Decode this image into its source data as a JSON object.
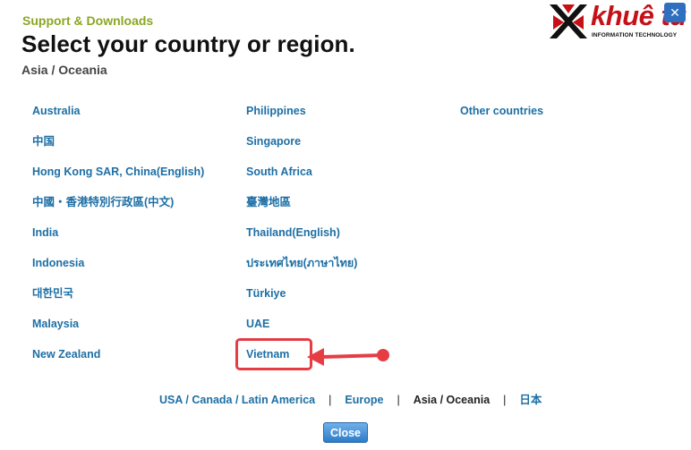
{
  "header": {
    "section": "Support & Downloads",
    "title": "Select your country or region.",
    "current_region": "Asia / Oceania"
  },
  "logo": {
    "brand": "khuê tú",
    "tagline": "INFORMATION TECHNOLOGY",
    "icon": "x-mark-logo-icon"
  },
  "columns": {
    "col1": [
      "Australia",
      "中国",
      "Hong Kong SAR, China(English)",
      "中國・香港特別行政區(中文)",
      "India",
      "Indonesia",
      "대한민국",
      "Malaysia",
      "New Zealand"
    ],
    "col2": [
      "Philippines",
      "Singapore",
      "South Africa",
      "臺灣地區",
      "Thailand(English)",
      "ประเทศไทย(ภาษาไทย)",
      "Türkiye",
      "UAE",
      "Vietnam"
    ],
    "col3": [
      "Other countries"
    ]
  },
  "regions": [
    "USA / Canada / Latin America",
    "Europe",
    "Asia / Oceania",
    "日本"
  ],
  "close_label": "Close",
  "colors": {
    "link": "#1d6fa5",
    "accent_green": "#8aa623",
    "annotation_red": "#e63d45",
    "brand_red": "#c61018"
  }
}
